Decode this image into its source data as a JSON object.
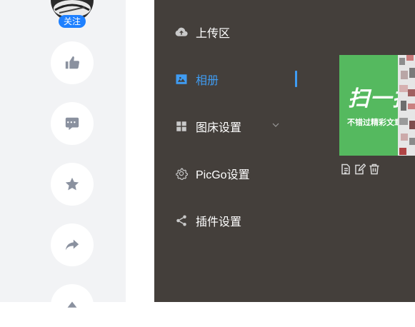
{
  "social": {
    "follow_label": "关注",
    "actions": [
      "thumbs-up-icon",
      "comment-icon",
      "star-icon",
      "share-icon",
      "up-icon"
    ]
  },
  "menu": {
    "items": [
      {
        "label": "上传区",
        "icon": "cloud-upload-icon",
        "active": false
      },
      {
        "label": "相册",
        "icon": "image-icon",
        "active": true
      },
      {
        "label": "图床设置",
        "icon": "grid-icon",
        "active": false,
        "has_submenu": true
      },
      {
        "label": "PicGo设置",
        "icon": "gear-icon",
        "active": false
      },
      {
        "label": "插件设置",
        "icon": "share-nodes-icon",
        "active": false
      }
    ]
  },
  "gallery": {
    "thumb_title": "扫一扫",
    "thumb_subtitle": "不错过精彩文章！",
    "tools": [
      "copy-icon",
      "edit-icon",
      "delete-icon"
    ]
  },
  "colors": {
    "accent": "#3f9cf3",
    "app_bg": "#443f3b",
    "rail_bg": "#f2f3f5",
    "thumb_bg": "#55b95f",
    "follow_badge": "#1e80ff"
  }
}
